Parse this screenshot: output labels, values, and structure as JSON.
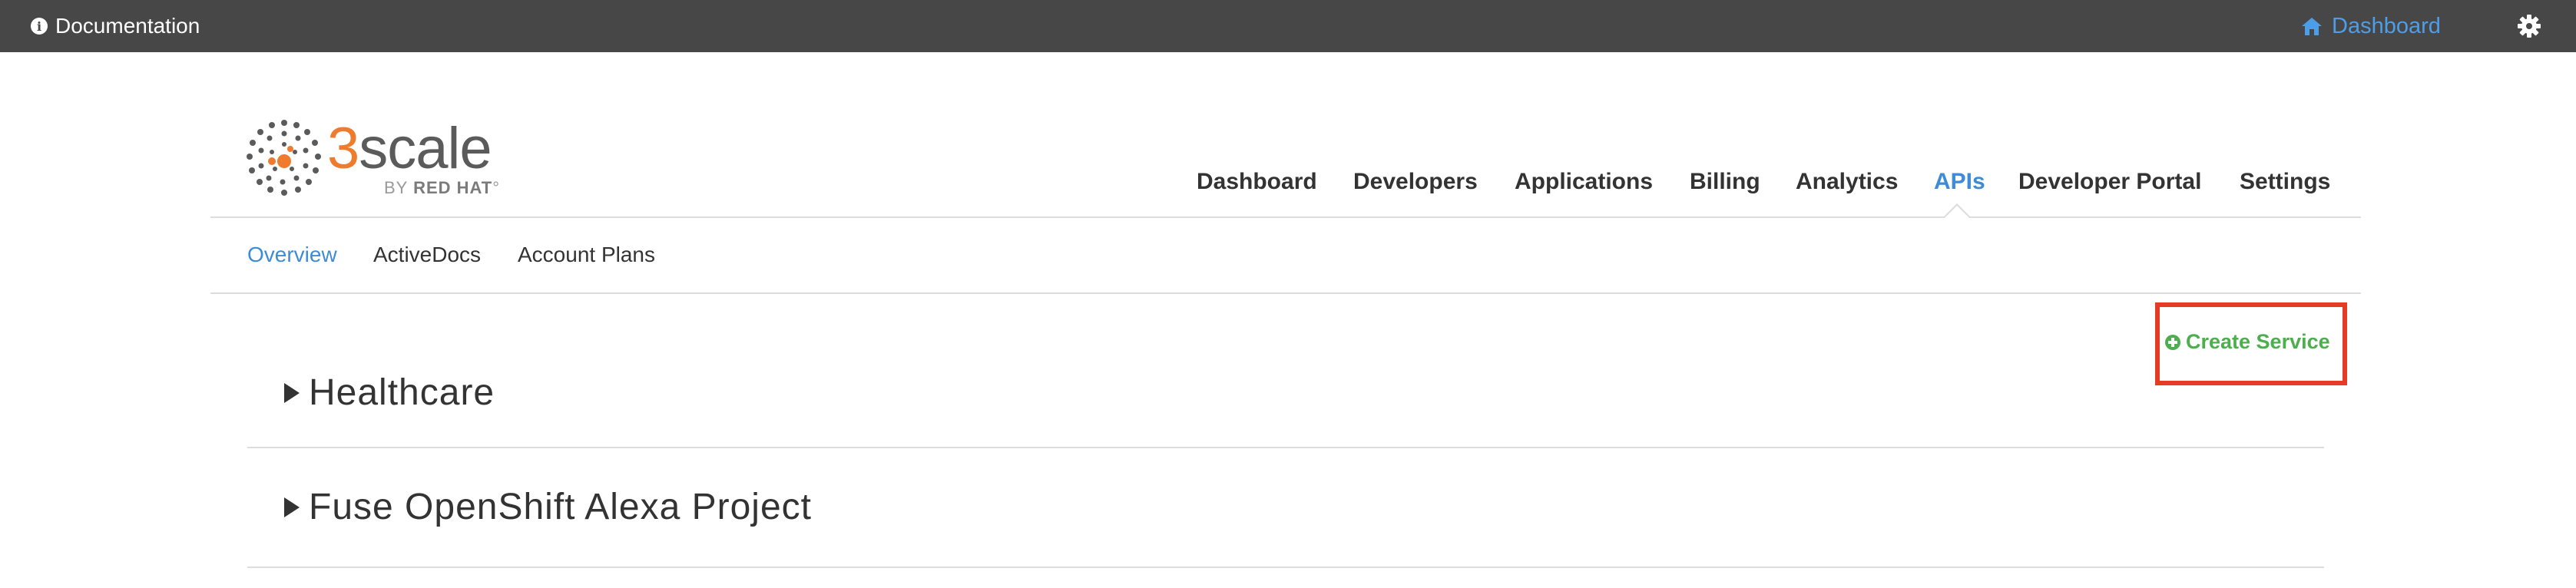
{
  "topbar": {
    "documentation_label": "Documentation",
    "info_icon": "info-icon",
    "dashboard_label": "Dashboard",
    "home_icon": "home-icon",
    "settings_icon": "gear-icon"
  },
  "logo": {
    "brand_num": "3",
    "brand_word": "scale",
    "sub_by": "BY",
    "sub_company": "RED HAT"
  },
  "main_nav": {
    "items": [
      {
        "label": "Dashboard"
      },
      {
        "label": "Developers"
      },
      {
        "label": "Applications"
      },
      {
        "label": "Billing"
      },
      {
        "label": "Analytics"
      },
      {
        "label": "APIs",
        "active": true
      },
      {
        "label": "Developer Portal"
      },
      {
        "label": "Settings"
      }
    ]
  },
  "sub_nav": {
    "items": [
      {
        "label": "Overview",
        "active": true
      },
      {
        "label": "ActiveDocs"
      },
      {
        "label": "Account Plans"
      }
    ]
  },
  "actions": {
    "create_service_label": "Create Service",
    "create_icon": "plus-circle-icon"
  },
  "services": [
    {
      "name": "Healthcare",
      "icon": "caret-right-icon"
    },
    {
      "name": "Fuse OpenShift Alexa Project",
      "icon": "caret-right-icon"
    }
  ],
  "colors": {
    "topbar_bg": "#474747",
    "link_blue": "#3e8bd6",
    "accent_orange": "#ee7b2e",
    "create_green": "#4cae4c",
    "highlight_red": "#e53a24"
  }
}
